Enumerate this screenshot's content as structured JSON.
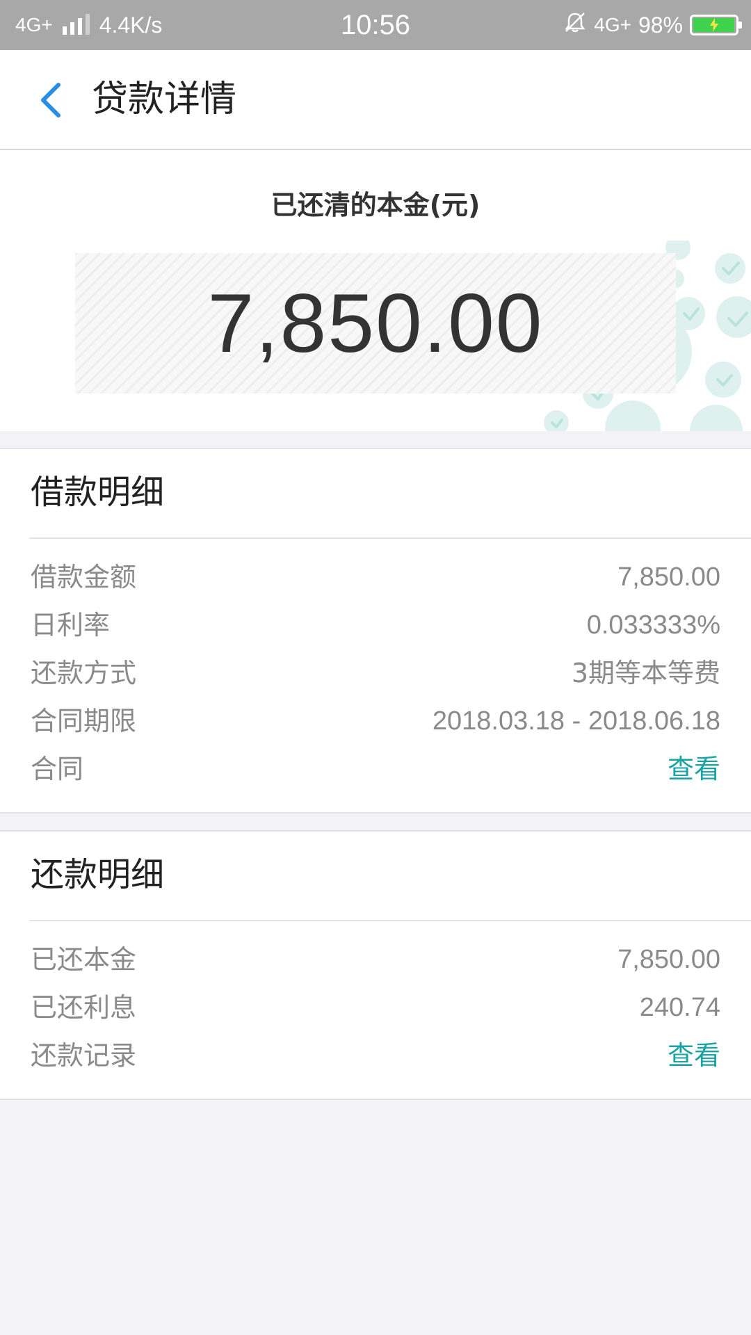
{
  "status_bar": {
    "network_left": "4G+",
    "speed": "4.4K/s",
    "time": "10:56",
    "network_right": "4G+",
    "battery_percent": "98%",
    "battery_level": 0.98,
    "battery_color": "#3fd24d",
    "icons": [
      "signal-icon",
      "mute-bell-icon",
      "battery-icon",
      "charging-icon"
    ]
  },
  "nav": {
    "title": "贷款详情",
    "back_icon": "chevron-left-icon",
    "accent": "#2b8ee6"
  },
  "hero": {
    "label": "已还清的本金(元)",
    "amount": "7,850.00"
  },
  "loan_details": {
    "title": "借款明细",
    "rows": [
      {
        "label": "借款金额",
        "value": "7,850.00"
      },
      {
        "label": "日利率",
        "value": "0.033333%"
      },
      {
        "label": "还款方式",
        "value": "3期等本等费"
      },
      {
        "label": "合同期限",
        "value": "2018.03.18 - 2018.06.18"
      },
      {
        "label": "合同",
        "link": "查看"
      }
    ]
  },
  "repayment_details": {
    "title": "还款明细",
    "rows": [
      {
        "label": "已还本金",
        "value": "7,850.00"
      },
      {
        "label": "已还利息",
        "value": "240.74"
      },
      {
        "label": "还款记录",
        "link": "查看"
      }
    ]
  },
  "colors": {
    "link": "#1aa3a3",
    "background": "#f3f3f7"
  }
}
